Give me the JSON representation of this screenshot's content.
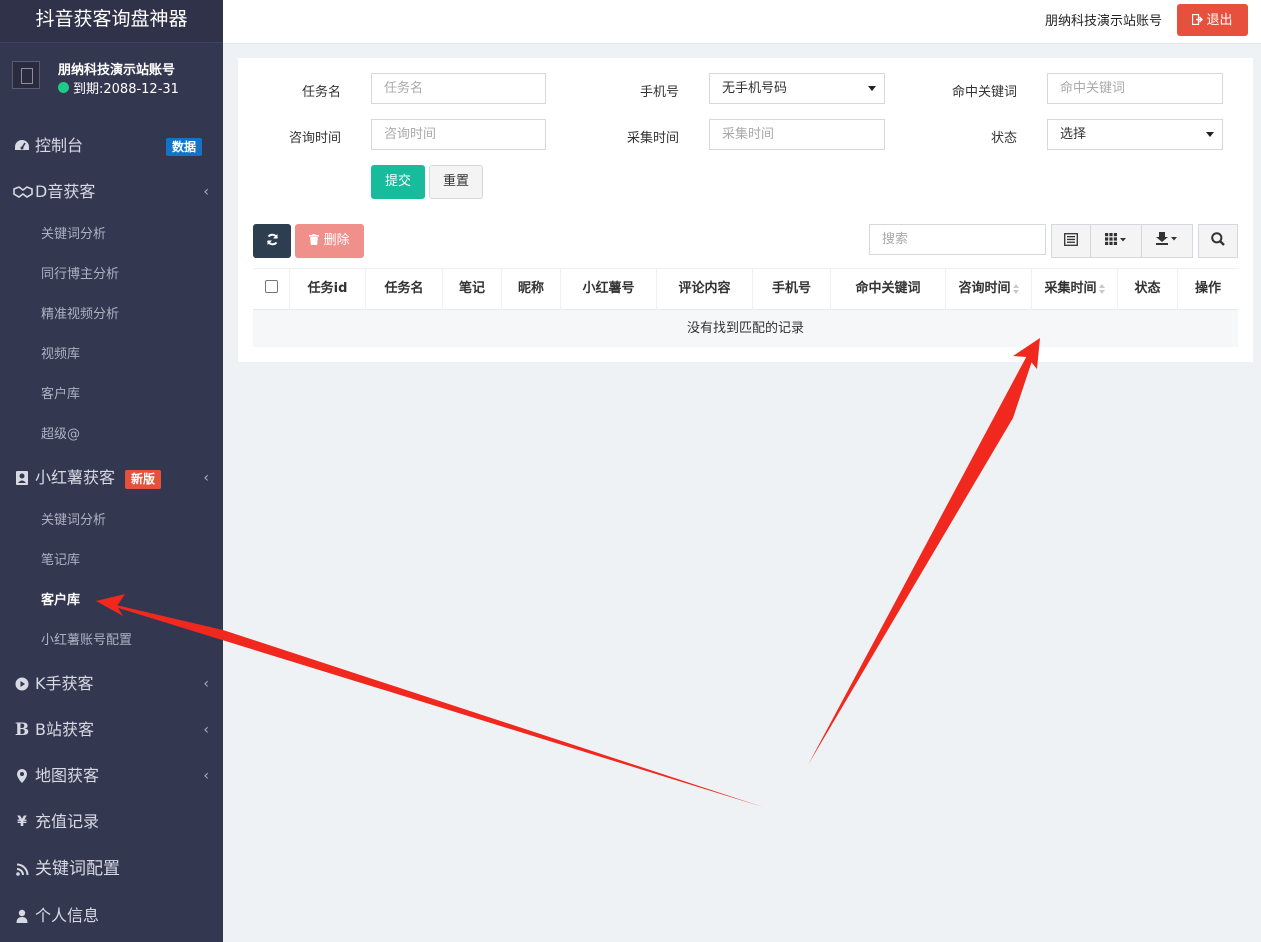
{
  "app": {
    "title": "抖音获客询盘神器",
    "account_name": "朋纳科技演示站账号",
    "expiry": "到期:2088-12-31"
  },
  "header": {
    "account": "朋纳科技演示站账号",
    "logout_label": "退出"
  },
  "sidebar": {
    "dashboard": {
      "label": "控制台",
      "badge": "数据"
    },
    "douyin": {
      "label": "D音获客",
      "items": [
        "关键词分析",
        "同行博主分析",
        "精准视频分析",
        "视频库",
        "客户库",
        "超级@"
      ]
    },
    "xiaohongshu": {
      "label": "小红薯获客",
      "badge": "新版",
      "items": [
        "关键词分析",
        "笔记库",
        "客户库",
        "小红薯账号配置"
      ],
      "active_index": 2
    },
    "kuaishou": {
      "label": "K手获客"
    },
    "bilibili": {
      "label": "B站获客"
    },
    "map": {
      "label": "地图获客"
    },
    "recharge": {
      "label": "充值记录"
    },
    "keywords": {
      "label": "关键词配置"
    },
    "profile": {
      "label": "个人信息"
    }
  },
  "filters": {
    "task_name": {
      "label": "任务名",
      "placeholder": "任务名"
    },
    "phone": {
      "label": "手机号",
      "selected": "无手机号码"
    },
    "hit_keyword": {
      "label": "命中关键词",
      "placeholder": "命中关键词"
    },
    "consult_time": {
      "label": "咨询时间",
      "placeholder": "咨询时间"
    },
    "collect_time": {
      "label": "采集时间",
      "placeholder": "采集时间"
    },
    "status": {
      "label": "状态",
      "selected": "选择"
    },
    "submit_label": "提交",
    "reset_label": "重置"
  },
  "toolbar": {
    "delete_label": "删除",
    "search_placeholder": "搜索"
  },
  "table": {
    "columns": [
      "任务id",
      "任务名",
      "笔记",
      "昵称",
      "小红薯号",
      "评论内容",
      "手机号",
      "命中关键词",
      "咨询时间",
      "采集时间",
      "状态",
      "操作"
    ],
    "empty_message": "没有找到匹配的记录"
  },
  "colors": {
    "sidebar_bg": "#343750",
    "accent_green": "#18bc9c",
    "danger": "#e8503e",
    "badge_blue": "#1174c9",
    "annotation_arrow": "#f0281e"
  }
}
